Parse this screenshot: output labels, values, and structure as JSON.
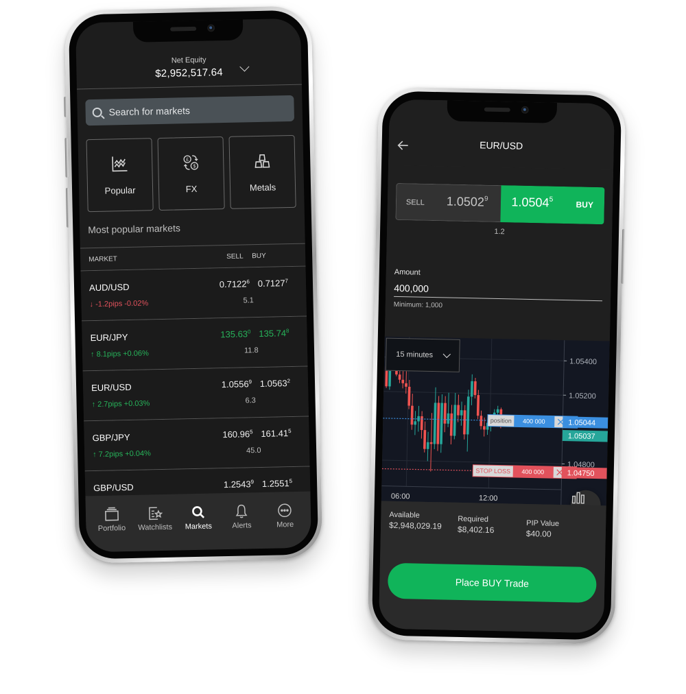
{
  "left_phone": {
    "header": {
      "label": "Net Equity",
      "value": "$2,952,517.64"
    },
    "search": {
      "placeholder": "Search for markets"
    },
    "tiles": [
      {
        "label": "Popular",
        "icon": "chart-line-icon"
      },
      {
        "label": "FX",
        "icon": "currency-exchange-icon"
      },
      {
        "label": "Metals",
        "icon": "gold-bars-icon"
      }
    ],
    "section_title": "Most popular markets",
    "table": {
      "columns": {
        "market": "MARKET",
        "sell": "SELL",
        "buy": "BUY"
      },
      "rows": [
        {
          "market": "AUD/USD",
          "sell": "0.7122",
          "sell_sup": "6",
          "buy": "0.7127",
          "buy_sup": "7",
          "spread": "5.1",
          "direction": "down",
          "arrow": "↓",
          "change": "-1.2pips -0.02%",
          "price_color": "neutral"
        },
        {
          "market": "EUR/JPY",
          "sell": "135.63",
          "sell_sup": "0",
          "buy": "135.74",
          "buy_sup": "8",
          "spread": "11.8",
          "direction": "up",
          "arrow": "↑",
          "change": "8.1pips +0.06%",
          "price_color": "green"
        },
        {
          "market": "EUR/USD",
          "sell": "1.0556",
          "sell_sup": "9",
          "buy": "1.0563",
          "buy_sup": "2",
          "spread": "6.3",
          "direction": "up",
          "arrow": "↑",
          "change": "2.7pips +0.03%",
          "price_color": "neutral"
        },
        {
          "market": "GBP/JPY",
          "sell": "160.96",
          "sell_sup": "5",
          "buy": "161.41",
          "buy_sup": "5",
          "spread": "45.0",
          "direction": "up",
          "arrow": "↑",
          "change": "7.2pips +0.04%",
          "price_color": "neutral"
        },
        {
          "market": "GBP/USD",
          "sell": "1.2543",
          "sell_sup": "9",
          "buy": "1.2551",
          "buy_sup": "5",
          "spread": "",
          "direction": "",
          "arrow": "",
          "change": "",
          "price_color": "neutral"
        }
      ]
    },
    "tabbar": [
      {
        "label": "Portfolio",
        "icon": "portfolio-icon",
        "active": false
      },
      {
        "label": "Watchlists",
        "icon": "watchlist-icon",
        "active": false
      },
      {
        "label": "Markets",
        "icon": "search-icon",
        "active": true
      },
      {
        "label": "Alerts",
        "icon": "bell-icon",
        "active": false
      },
      {
        "label": "More",
        "icon": "more-icon",
        "active": false
      }
    ]
  },
  "right_phone": {
    "title": "EUR/USD",
    "sell": {
      "label": "SELL",
      "price": "1.0502",
      "sup": "9"
    },
    "buy": {
      "label": "BUY",
      "price": "1.0504",
      "sup": "5"
    },
    "spread": "1.2",
    "amount": {
      "label": "Amount",
      "value": "400,000",
      "hint": "Minimum: 1,000"
    },
    "chart": {
      "timeframe": "15 minutes",
      "y_ticks": [
        "1.05400",
        "1.05200",
        "1.04800"
      ],
      "x_ticks": [
        "06:00",
        "12:00"
      ],
      "position_line": {
        "label": "position",
        "size": "400 000",
        "price": "1.05044"
      },
      "current_price": "1.05037",
      "stop_loss_line": {
        "label": "STOP LOSS",
        "size": "400 000",
        "price": "1.04750"
      }
    },
    "stats": [
      {
        "label": "Available",
        "value": "$2,948,029.19"
      },
      {
        "label": "Required",
        "value": "$8,402.16"
      },
      {
        "label": "PIP Value",
        "value": "$40.00"
      }
    ],
    "place_button": "Place BUY Trade"
  },
  "colors": {
    "green": "#10b45a",
    "up": "#27b35a",
    "down": "#e2525c",
    "candle_up": "#26a69a",
    "candle_down": "#ef5350",
    "position_blue": "#3b8fe0",
    "stop_red": "#e2525c"
  },
  "chart_data": {
    "type": "candlestick",
    "title": "",
    "xlabel": "",
    "ylabel": "",
    "x_ticks": [
      "06:00",
      "12:00"
    ],
    "y_ticks": [
      1.054,
      1.052,
      1.048
    ],
    "ylim": [
      1.0465,
      1.0552
    ],
    "lines": [
      {
        "name": "position",
        "value": 1.05044
      },
      {
        "name": "current",
        "value": 1.05037
      },
      {
        "name": "stop loss",
        "value": 1.0475
      }
    ],
    "candles": [
      {
        "o": 1.0535,
        "h": 1.0537,
        "l": 1.0522,
        "c": 1.0523
      },
      {
        "o": 1.0523,
        "h": 1.0539,
        "l": 1.0521,
        "c": 1.0537
      },
      {
        "o": 1.0537,
        "h": 1.0545,
        "l": 1.0534,
        "c": 1.0539
      },
      {
        "o": 1.054,
        "h": 1.0547,
        "l": 1.0529,
        "c": 1.053
      },
      {
        "o": 1.053,
        "h": 1.0535,
        "l": 1.0525,
        "c": 1.0527
      },
      {
        "o": 1.0527,
        "h": 1.0533,
        "l": 1.0522,
        "c": 1.0525
      },
      {
        "o": 1.0525,
        "h": 1.0532,
        "l": 1.0519,
        "c": 1.0523
      },
      {
        "o": 1.0523,
        "h": 1.0527,
        "l": 1.051,
        "c": 1.0512
      },
      {
        "o": 1.0512,
        "h": 1.0519,
        "l": 1.0498,
        "c": 1.0501
      },
      {
        "o": 1.0501,
        "h": 1.0509,
        "l": 1.0495,
        "c": 1.0503
      },
      {
        "o": 1.0503,
        "h": 1.0512,
        "l": 1.0497,
        "c": 1.0506
      },
      {
        "o": 1.0506,
        "h": 1.0509,
        "l": 1.0493,
        "c": 1.0498
      },
      {
        "o": 1.0498,
        "h": 1.0503,
        "l": 1.0485,
        "c": 1.0487
      },
      {
        "o": 1.0487,
        "h": 1.0497,
        "l": 1.048,
        "c": 1.0491
      },
      {
        "o": 1.0491,
        "h": 1.0508,
        "l": 1.0474,
        "c": 1.049
      },
      {
        "o": 1.049,
        "h": 1.0523,
        "l": 1.0487,
        "c": 1.0514
      },
      {
        "o": 1.0514,
        "h": 1.0518,
        "l": 1.0486,
        "c": 1.049
      },
      {
        "o": 1.049,
        "h": 1.0519,
        "l": 1.0485,
        "c": 1.0514
      },
      {
        "o": 1.0514,
        "h": 1.0518,
        "l": 1.0497,
        "c": 1.0502
      },
      {
        "o": 1.0502,
        "h": 1.052,
        "l": 1.05,
        "c": 1.0508
      },
      {
        "o": 1.0508,
        "h": 1.0513,
        "l": 1.049,
        "c": 1.0495
      },
      {
        "o": 1.0495,
        "h": 1.052,
        "l": 1.0493,
        "c": 1.0513
      },
      {
        "o": 1.0513,
        "h": 1.0519,
        "l": 1.0503,
        "c": 1.0507
      },
      {
        "o": 1.0507,
        "h": 1.0515,
        "l": 1.0501,
        "c": 1.051
      },
      {
        "o": 1.051,
        "h": 1.0513,
        "l": 1.0493,
        "c": 1.0496
      },
      {
        "o": 1.0496,
        "h": 1.0522,
        "l": 1.0486,
        "c": 1.0518
      },
      {
        "o": 1.0518,
        "h": 1.0531,
        "l": 1.0513,
        "c": 1.0527
      },
      {
        "o": 1.0527,
        "h": 1.0529,
        "l": 1.0517,
        "c": 1.0519
      },
      {
        "o": 1.0519,
        "h": 1.0522,
        "l": 1.0505,
        "c": 1.0507
      },
      {
        "o": 1.0507,
        "h": 1.051,
        "l": 1.0499,
        "c": 1.0501
      },
      {
        "o": 1.0501,
        "h": 1.0506,
        "l": 1.0495,
        "c": 1.0499
      },
      {
        "o": 1.0499,
        "h": 1.0505,
        "l": 1.0496,
        "c": 1.0503
      },
      {
        "o": 1.0503,
        "h": 1.0507,
        "l": 1.0498,
        "c": 1.0505
      },
      {
        "o": 1.0505,
        "h": 1.0511,
        "l": 1.0503,
        "c": 1.0509
      },
      {
        "o": 1.0509,
        "h": 1.0513,
        "l": 1.0506,
        "c": 1.0511
      },
      {
        "o": 1.0511,
        "h": 1.0512,
        "l": 1.05,
        "c": 1.0503
      }
    ]
  }
}
